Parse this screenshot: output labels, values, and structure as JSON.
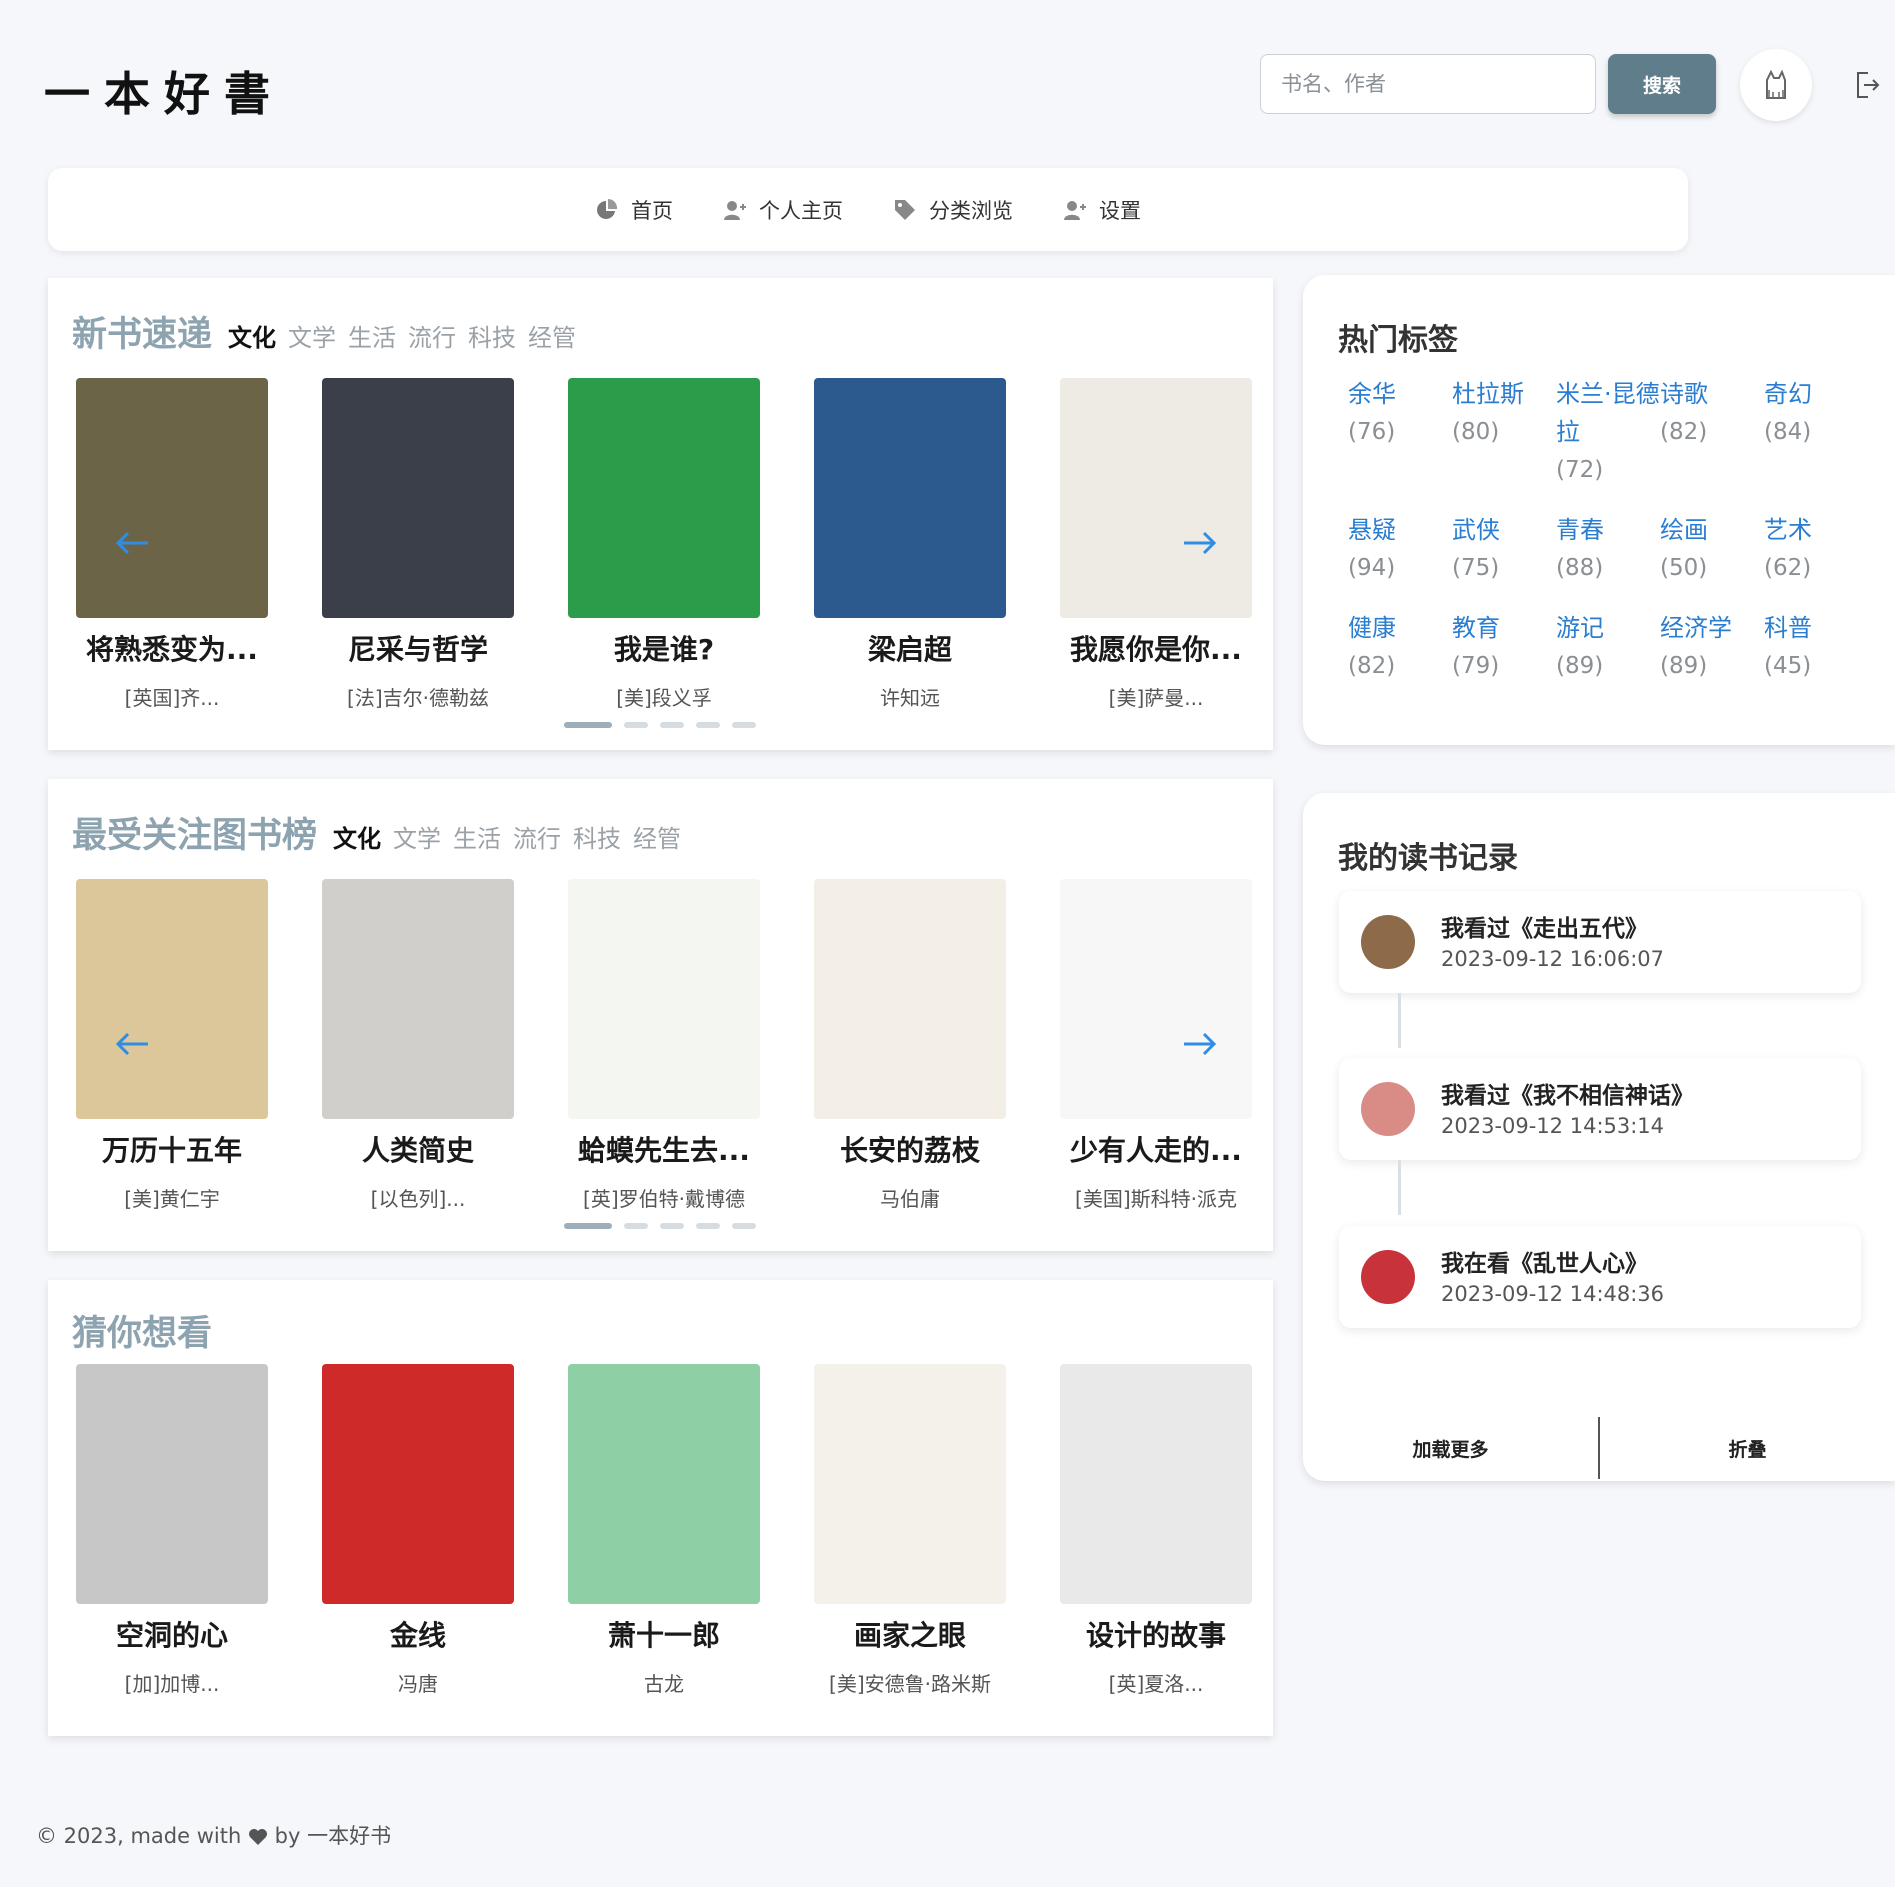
{
  "header": {
    "logo": "一本好書",
    "search_placeholder": "书名、作者",
    "search_button": "搜索"
  },
  "nav": [
    {
      "label": "首页",
      "icon": "pie-chart-icon"
    },
    {
      "label": "个人主页",
      "icon": "user-plus-icon"
    },
    {
      "label": "分类浏览",
      "icon": "tag-icon"
    },
    {
      "label": "设置",
      "icon": "user-plus-icon"
    }
  ],
  "new_books": {
    "title": "新书速递",
    "categories": [
      "文化",
      "文学",
      "生活",
      "流行",
      "科技",
      "经管"
    ],
    "active_category": "文化",
    "books": [
      {
        "title": "将熟悉变为...",
        "author": "[英国]齐...",
        "color": "#6b6447"
      },
      {
        "title": "尼采与哲学",
        "author": "[法]吉尔·德勒兹",
        "color": "#3a3f4a"
      },
      {
        "title": "我是谁?",
        "author": "[美]段义孚",
        "color": "#2a9c4a"
      },
      {
        "title": "梁启超",
        "author": "许知远",
        "color": "#2d5a8e"
      },
      {
        "title": "我愿你是你...",
        "author": "[美]萨曼...",
        "color": "#eeeae4"
      }
    ]
  },
  "popular_books": {
    "title": "最受关注图书榜",
    "categories": [
      "文化",
      "文学",
      "生活",
      "流行",
      "科技",
      "经管"
    ],
    "active_category": "文化",
    "books": [
      {
        "title": "万历十五年",
        "author": "[美]黄仁宇",
        "color": "#dcc79a"
      },
      {
        "title": "人类简史",
        "author": "[以色列]...",
        "color": "#d0cfcb"
      },
      {
        "title": "蛤蟆先生去...",
        "author": "[英]罗伯特·戴博德",
        "color": "#f4f6f2"
      },
      {
        "title": "长安的荔枝",
        "author": "马伯庸",
        "color": "#f3efe6"
      },
      {
        "title": "少有人走的...",
        "author": "[美国]斯科特·派克",
        "color": "#f7f7f7"
      }
    ]
  },
  "guess_books": {
    "title": "猜你想看",
    "books": [
      {
        "title": "空洞的心",
        "author": "[加]加博...",
        "color": "#c7c7c7"
      },
      {
        "title": "金线",
        "author": "冯唐",
        "color": "#cf2a2a"
      },
      {
        "title": "萧十一郎",
        "author": "古龙",
        "color": "#8fcfa6"
      },
      {
        "title": "画家之眼",
        "author": "[美]安德鲁·路米斯",
        "color": "#f3f1ea"
      },
      {
        "title": "设计的故事",
        "author": "[英]夏洛...",
        "color": "#e9e9e9"
      }
    ]
  },
  "hot_tags": {
    "title": "热门标签",
    "tags": [
      {
        "name": "余华",
        "count": "(76)"
      },
      {
        "name": "杜拉斯",
        "count": "(80)"
      },
      {
        "name": "米兰·昆德拉",
        "count": "(72)"
      },
      {
        "name": "诗歌",
        "count": "(82)"
      },
      {
        "name": "奇幻",
        "count": "(84)"
      },
      {
        "name": "悬疑",
        "count": "(94)"
      },
      {
        "name": "武侠",
        "count": "(75)"
      },
      {
        "name": "青春",
        "count": "(88)"
      },
      {
        "name": "绘画",
        "count": "(50)"
      },
      {
        "name": "艺术",
        "count": "(62)"
      },
      {
        "name": "健康",
        "count": "(82)"
      },
      {
        "name": "教育",
        "count": "(79)"
      },
      {
        "name": "游记",
        "count": "(89)"
      },
      {
        "name": "经济学",
        "count": "(89)"
      },
      {
        "name": "科普",
        "count": "(45)"
      }
    ]
  },
  "reading_log": {
    "title": "我的读书记录",
    "records": [
      {
        "text": "我看过《走出五代》",
        "time": "2023-09-12 16:06:07",
        "color": "#8c6a4a"
      },
      {
        "text": "我看过《我不相信神话》",
        "time": "2023-09-12 14:53:14",
        "color": "#d98b86"
      },
      {
        "text": "我在看《乱世人心》",
        "time": "2023-09-12 14:48:36",
        "color": "#c8323a"
      }
    ],
    "load_more": "加载更多",
    "collapse": "折叠"
  },
  "footer": {
    "prefix": "© 2023, made with",
    "suffix": "by 一本好书"
  }
}
